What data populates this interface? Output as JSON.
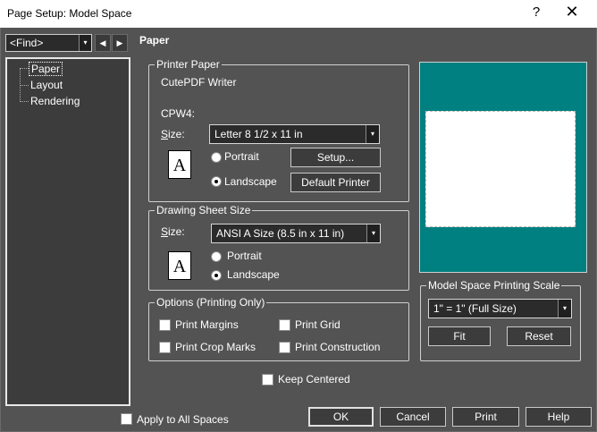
{
  "window": {
    "title": "Page Setup: Model Space",
    "help_label": "?",
    "close_label": "✕"
  },
  "find": {
    "value": "<Find>"
  },
  "tree": {
    "items": [
      {
        "label": "Paper"
      },
      {
        "label": "Layout"
      },
      {
        "label": "Rendering"
      }
    ]
  },
  "section": {
    "title": "Paper"
  },
  "printer_paper": {
    "legend": "Printer Paper",
    "printer_name": "CutePDF Writer",
    "port": "CPW4:",
    "size_label_u": "S",
    "size_label_rest": "ize:",
    "size_value": "Letter 8 1/2 x 11 in",
    "portrait_label": "Portrait",
    "landscape_label": "Landscape",
    "orientation_selected": "Landscape",
    "setup_button": "Setup...",
    "default_printer_button": "Default Printer",
    "icon_letter": "A"
  },
  "drawing_sheet": {
    "legend": "Drawing Sheet Size",
    "size_label_u": "S",
    "size_label_rest": "ize:",
    "size_value": "ANSI A Size (8.5 in x 11 in)",
    "portrait_label": "Portrait",
    "landscape_label": "Landscape",
    "orientation_selected": "Landscape",
    "icon_letter": "A"
  },
  "options": {
    "legend": "Options (Printing Only)",
    "print_margins": "Print Margins",
    "print_grid": "Print Grid",
    "print_crop_marks": "Print Crop Marks",
    "print_construction": "Print Construction"
  },
  "keep_centered": {
    "label": "Keep Centered"
  },
  "scale": {
    "legend": "Model Space Printing Scale",
    "value": "1\" = 1\" (Full Size)",
    "fit_button": "Fit",
    "reset_button": "Reset"
  },
  "footer": {
    "apply_all": "Apply to All Spaces",
    "ok": "OK",
    "cancel": "Cancel",
    "print": "Print",
    "help": "Help"
  },
  "icons": {
    "dropdown": "▾",
    "nav_left": "◀",
    "nav_right": "▶"
  },
  "colors": {
    "preview_bg": "#008080",
    "dialog_bg": "#535353"
  }
}
